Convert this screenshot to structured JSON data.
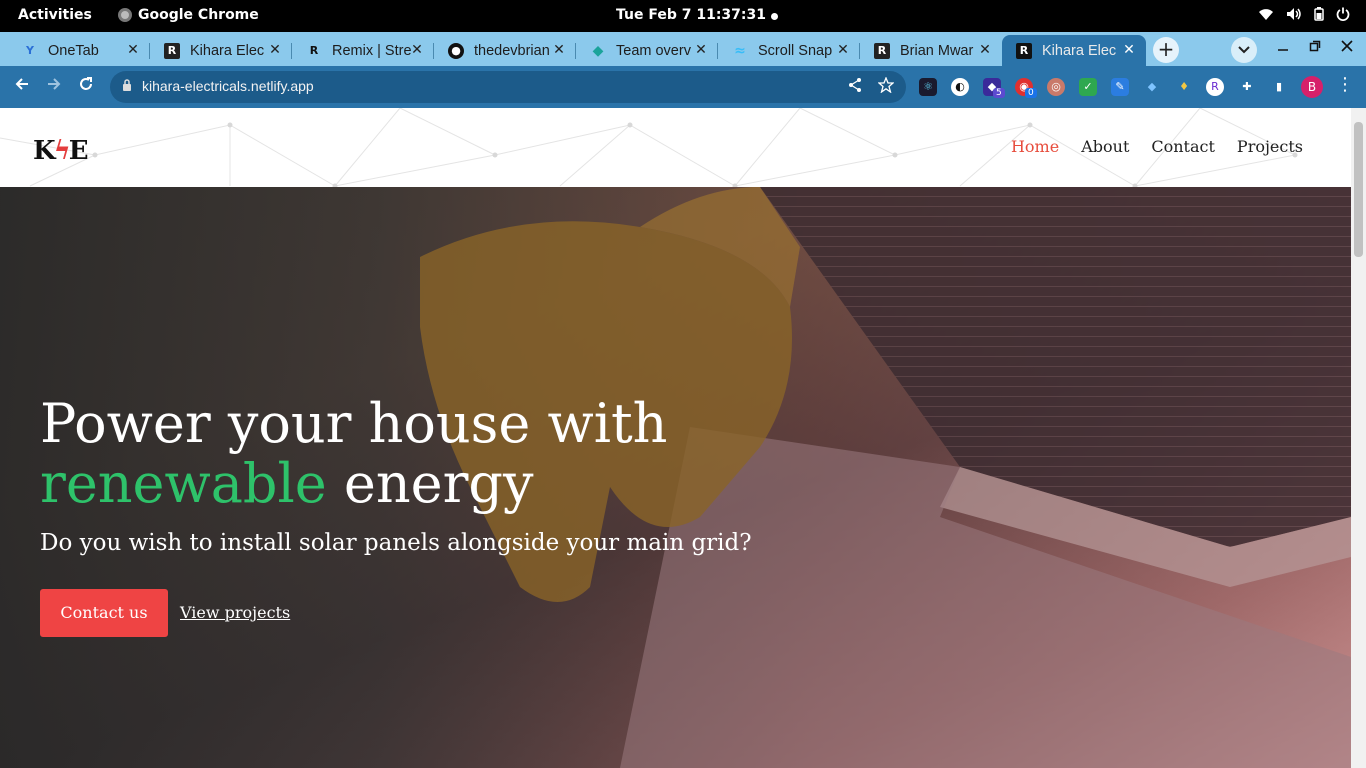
{
  "system_bar": {
    "activities": "Activities",
    "app_name": "Google Chrome",
    "clock": "Tue Feb 7  11:37:31",
    "icons": [
      "wifi-icon",
      "volume-icon",
      "battery-icon",
      "power-icon"
    ]
  },
  "tabs": [
    {
      "label": "OneTab",
      "icon": "onetab-icon",
      "active": false
    },
    {
      "label": "Kihara Elec",
      "icon": "remix-icon",
      "active": false
    },
    {
      "label": "Remix | Stre",
      "icon": "remix-icon",
      "active": false
    },
    {
      "label": "thedevbrian",
      "icon": "github-icon",
      "active": false
    },
    {
      "label": "Team overv",
      "icon": "netlify-icon",
      "active": false
    },
    {
      "label": "Scroll Snap",
      "icon": "tailwind-icon",
      "active": false
    },
    {
      "label": "Brian Mwar",
      "icon": "remix-icon",
      "active": false
    },
    {
      "label": "Kihara Elec",
      "icon": "remix-icon",
      "active": true
    }
  ],
  "address_bar": {
    "url": "kihara-electricals.netlify.app"
  },
  "extensions": {
    "badge_1": "5",
    "badge_2": "0",
    "profile_initial": "B"
  },
  "site": {
    "logo": {
      "k": "K",
      "e": "E"
    },
    "nav": [
      "Home",
      "About",
      "Contact",
      "Projects"
    ],
    "hero": {
      "headline_line1": "Power your house with",
      "headline_green": "renewable",
      "headline_rest": " energy",
      "subheadline": "Do you wish to install solar panels alongside your main grid?",
      "primary_cta": "Contact us",
      "secondary_cta": "View projects"
    }
  },
  "colors": {
    "tab_strip": "#8bc9ec",
    "toolbar": "#2a73a9",
    "accent_red": "#ef4444",
    "accent_green": "#2ec26a",
    "nav_active": "#e74c3c"
  }
}
